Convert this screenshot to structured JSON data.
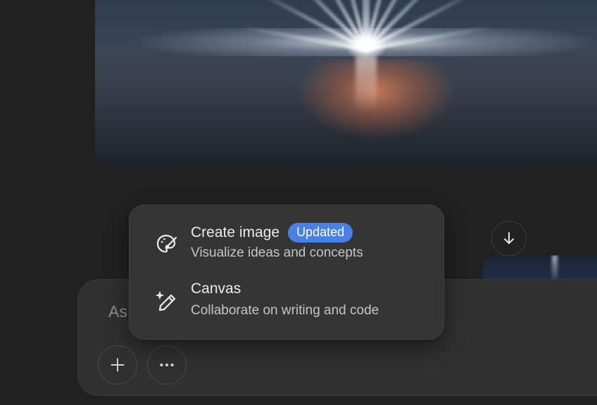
{
  "composer": {
    "placeholder": "Ask anything",
    "placeholder_visible": "As"
  },
  "popup": {
    "items": [
      {
        "title": "Create image",
        "badge": "Updated",
        "subtitle": "Visualize ideas and concepts",
        "icon": "palette-brush-icon"
      },
      {
        "title": "Canvas",
        "subtitle": "Collaborate on writing and code",
        "icon": "sparkle-pencil-icon"
      }
    ]
  },
  "colors": {
    "background": "#212121",
    "composer_bg": "#303030",
    "popup_bg": "#353535",
    "badge_bg": "#4a7fe6",
    "text_primary": "#ececec",
    "text_secondary": "#c4c4c4",
    "placeholder": "#8e8e8e"
  },
  "icons": {
    "plus": "plus-icon",
    "more": "more-horizontal-icon",
    "scroll_down": "arrow-down-icon"
  }
}
